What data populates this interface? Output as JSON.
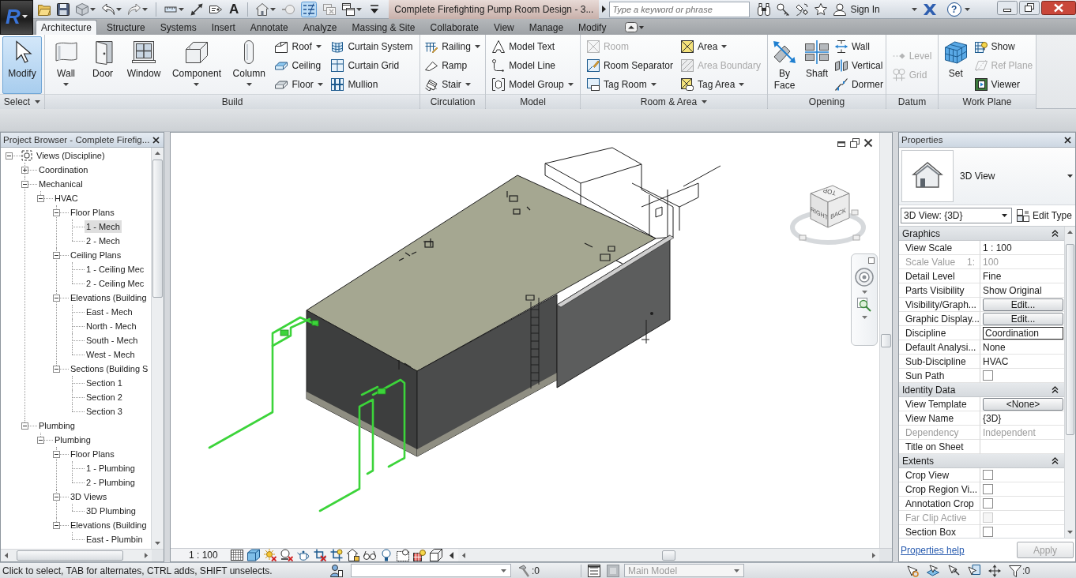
{
  "app_logo": "R",
  "quick_access": {
    "text_tool": "A",
    "thin_lines": true
  },
  "title_bar": {
    "title": "Complete Firefighting Pump Room Design - 3...",
    "search": {
      "placeholder": "Type a keyword or phrase"
    },
    "sign_in": "Sign In",
    "help": "?"
  },
  "tabs": [
    {
      "label": "Architecture",
      "selected": true
    },
    {
      "label": "Structure",
      "selected": false
    },
    {
      "label": "Systems",
      "selected": false
    },
    {
      "label": "Insert",
      "selected": false
    },
    {
      "label": "Annotate",
      "selected": false
    },
    {
      "label": "Analyze",
      "selected": false
    },
    {
      "label": "Massing & Site",
      "selected": false
    },
    {
      "label": "Collaborate",
      "selected": false
    },
    {
      "label": "View",
      "selected": false
    },
    {
      "label": "Manage",
      "selected": false
    },
    {
      "label": "Modify",
      "selected": false
    }
  ],
  "ribbon": {
    "panels": [
      {
        "title": "Select",
        "menu": true,
        "large": [
          {
            "label": "Modify",
            "active": true,
            "menu": false
          }
        ]
      },
      {
        "title": "Build",
        "menu": false,
        "large": [
          {
            "label": "Wall",
            "active": false,
            "menu": true
          },
          {
            "label": "Door",
            "active": false,
            "menu": false
          },
          {
            "label": "Window",
            "active": false,
            "menu": false
          },
          {
            "label": "Component",
            "active": false,
            "menu": true
          },
          {
            "label": "Column",
            "active": false,
            "menu": true
          }
        ],
        "columns": [
          [
            {
              "label": "Roof",
              "disabled": false,
              "menu": true
            },
            {
              "label": "Ceiling",
              "disabled": false,
              "menu": false
            },
            {
              "label": "Floor",
              "disabled": false,
              "menu": true
            }
          ],
          [
            {
              "label": "Curtain System",
              "disabled": false,
              "menu": false
            },
            {
              "label": "Curtain Grid",
              "disabled": false,
              "menu": false
            },
            {
              "label": "Mullion",
              "disabled": false,
              "menu": false
            }
          ]
        ]
      },
      {
        "title": "Circulation",
        "menu": false,
        "columns": [
          [
            {
              "label": "Railing",
              "disabled": false,
              "menu": true
            },
            {
              "label": "Ramp",
              "disabled": false,
              "menu": false
            },
            {
              "label": "Stair",
              "disabled": false,
              "menu": true
            }
          ]
        ]
      },
      {
        "title": "Model",
        "menu": false,
        "columns": [
          [
            {
              "label": "Model Text",
              "disabled": false,
              "menu": false
            },
            {
              "label": "Model Line",
              "disabled": false,
              "menu": false
            },
            {
              "label": "Model Group",
              "disabled": false,
              "menu": true
            }
          ]
        ]
      },
      {
        "title": "Room & Area",
        "menu": true,
        "columns": [
          [
            {
              "label": "Room",
              "disabled": true,
              "menu": false
            },
            {
              "label": "Room Separator",
              "disabled": false,
              "menu": false
            },
            {
              "label": "Tag Room",
              "disabled": false,
              "menu": true
            }
          ],
          [
            {
              "label": "Area",
              "disabled": false,
              "menu": true
            },
            {
              "label": "Area Boundary",
              "disabled": true,
              "menu": false
            },
            {
              "label": "Tag Area",
              "disabled": false,
              "menu": true
            }
          ]
        ]
      },
      {
        "title": "Opening",
        "menu": false,
        "large": [
          {
            "label": "By Face",
            "active": false,
            "menu": false
          },
          {
            "label": "Shaft",
            "active": false,
            "menu": false
          }
        ],
        "columns": [
          [
            {
              "label": "Wall",
              "disabled": false,
              "menu": false
            },
            {
              "label": "Vertical",
              "disabled": false,
              "menu": false
            },
            {
              "label": "Dormer",
              "disabled": false,
              "menu": false
            }
          ]
        ]
      },
      {
        "title": "Datum",
        "menu": false,
        "columns": [
          [
            {
              "label": "Level",
              "disabled": true,
              "menu": false
            },
            {
              "label": "Grid",
              "disabled": true,
              "menu": false
            }
          ]
        ]
      },
      {
        "title": "Work Plane",
        "menu": false,
        "large": [
          {
            "label": "Set",
            "active": false,
            "menu": false
          }
        ],
        "columns": [
          [
            {
              "label": "Show",
              "disabled": false,
              "menu": false
            },
            {
              "label": "Ref Plane",
              "disabled": true,
              "menu": false
            },
            {
              "label": "Viewer",
              "disabled": false,
              "menu": false
            }
          ]
        ]
      }
    ]
  },
  "project_browser": {
    "title": "Project Browser - Complete Firefig...",
    "tree": [
      {
        "label": "Views (Discipline)",
        "expanded": true,
        "selected": false,
        "children": [
          {
            "label": "Coordination",
            "expanded": false,
            "selected": false
          },
          {
            "label": "Mechanical",
            "expanded": true,
            "selected": false,
            "children": [
              {
                "label": "HVAC",
                "expanded": true,
                "selected": false,
                "children": [
                  {
                    "label": "Floor Plans",
                    "expanded": true,
                    "selected": false,
                    "children": [
                      {
                        "label": "1 - Mech",
                        "selected": true
                      },
                      {
                        "label": "2 - Mech",
                        "selected": false
                      }
                    ]
                  },
                  {
                    "label": "Ceiling Plans",
                    "expanded": true,
                    "selected": false,
                    "children": [
                      {
                        "label": "1 - Ceiling Mec",
                        "selected": false
                      },
                      {
                        "label": "2 - Ceiling Mec",
                        "selected": false
                      }
                    ]
                  },
                  {
                    "label": "Elevations (Building",
                    "expanded": true,
                    "selected": false,
                    "children": [
                      {
                        "label": "East - Mech",
                        "selected": false
                      },
                      {
                        "label": "North - Mech",
                        "selected": false
                      },
                      {
                        "label": "South - Mech",
                        "selected": false
                      },
                      {
                        "label": "West - Mech",
                        "selected": false
                      }
                    ]
                  },
                  {
                    "label": "Sections (Building S",
                    "expanded": true,
                    "selected": false,
                    "children": [
                      {
                        "label": "Section 1",
                        "selected": false
                      },
                      {
                        "label": "Section 2",
                        "selected": false
                      },
                      {
                        "label": "Section 3",
                        "selected": false
                      }
                    ]
                  }
                ]
              }
            ]
          },
          {
            "label": "Plumbing",
            "expanded": true,
            "selected": false,
            "children": [
              {
                "label": "Plumbing",
                "expanded": true,
                "selected": false,
                "children": [
                  {
                    "label": "Floor Plans",
                    "expanded": true,
                    "selected": false,
                    "children": [
                      {
                        "label": "1 - Plumbing",
                        "selected": false
                      },
                      {
                        "label": "2 - Plumbing",
                        "selected": false
                      }
                    ]
                  },
                  {
                    "label": "3D Views",
                    "expanded": true,
                    "selected": false,
                    "children": [
                      {
                        "label": "3D Plumbing",
                        "selected": false
                      }
                    ]
                  },
                  {
                    "label": "Elevations (Building",
                    "expanded": true,
                    "selected": false,
                    "children": [
                      {
                        "label": "East - Plumbin",
                        "selected": false
                      }
                    ]
                  }
                ]
              }
            ]
          }
        ]
      }
    ]
  },
  "view": {
    "scale": "1 : 100",
    "view_cube": {
      "faces": [
        "TOP",
        "RIGHT",
        "BACK"
      ]
    }
  },
  "properties": {
    "title": "Properties",
    "type_name": "3D View",
    "instance": "3D View: {3D}",
    "edit_type": "Edit Type",
    "groups": [
      {
        "title": "Graphics",
        "expanded": true,
        "rows": [
          {
            "kind": "text",
            "label": "View Scale",
            "value": "1 : 100",
            "disabled": false
          },
          {
            "kind": "text",
            "label": "Scale Value",
            "label_note": "1:",
            "value": "100",
            "disabled": true
          },
          {
            "kind": "text",
            "label": "Detail Level",
            "value": "Fine",
            "disabled": false
          },
          {
            "kind": "text",
            "label": "Parts Visibility",
            "value": "Show Original",
            "disabled": false
          },
          {
            "kind": "button",
            "label": "Visibility/Graph...",
            "value": "Edit...",
            "disabled": false
          },
          {
            "kind": "button",
            "label": "Graphic Display...",
            "value": "Edit...",
            "disabled": false
          },
          {
            "kind": "field",
            "label": "Discipline",
            "value": "Coordination",
            "disabled": false
          },
          {
            "kind": "text",
            "label": "Default Analysi...",
            "value": "None",
            "disabled": false
          },
          {
            "kind": "text",
            "label": "Sub-Discipline",
            "value": "HVAC",
            "disabled": false
          },
          {
            "kind": "checkbox",
            "label": "Sun Path",
            "checked": false,
            "disabled": false
          }
        ]
      },
      {
        "title": "Identity Data",
        "expanded": true,
        "rows": [
          {
            "kind": "button",
            "label": "View Template",
            "value": "<None>",
            "disabled": false
          },
          {
            "kind": "text",
            "label": "View Name",
            "value": "{3D}",
            "disabled": false
          },
          {
            "kind": "text",
            "label": "Dependency",
            "value": "Independent",
            "disabled": true
          },
          {
            "kind": "text",
            "label": "Title on Sheet",
            "disabled": false
          }
        ]
      },
      {
        "title": "Extents",
        "expanded": true,
        "rows": [
          {
            "kind": "checkbox",
            "label": "Crop View",
            "checked": false,
            "disabled": false
          },
          {
            "kind": "checkbox",
            "label": "Crop Region Vi...",
            "checked": false,
            "disabled": false
          },
          {
            "kind": "checkbox",
            "label": "Annotation Crop",
            "checked": false,
            "disabled": false
          },
          {
            "kind": "checkbox",
            "label": "Far Clip Active",
            "checked": false,
            "disabled": true
          },
          {
            "kind": "checkbox",
            "label": "Section Box",
            "checked": false,
            "disabled": false
          }
        ]
      }
    ],
    "help_link": "Properties help",
    "apply": {
      "label": "Apply",
      "disabled": true
    }
  },
  "status_bar": {
    "message": "Click to select, TAB for alternates, CTRL adds, SHIFT unselects.",
    "element_count": ":0",
    "design_option": {
      "value": "Main Model",
      "disabled": true
    },
    "selection_count": ":0"
  }
}
